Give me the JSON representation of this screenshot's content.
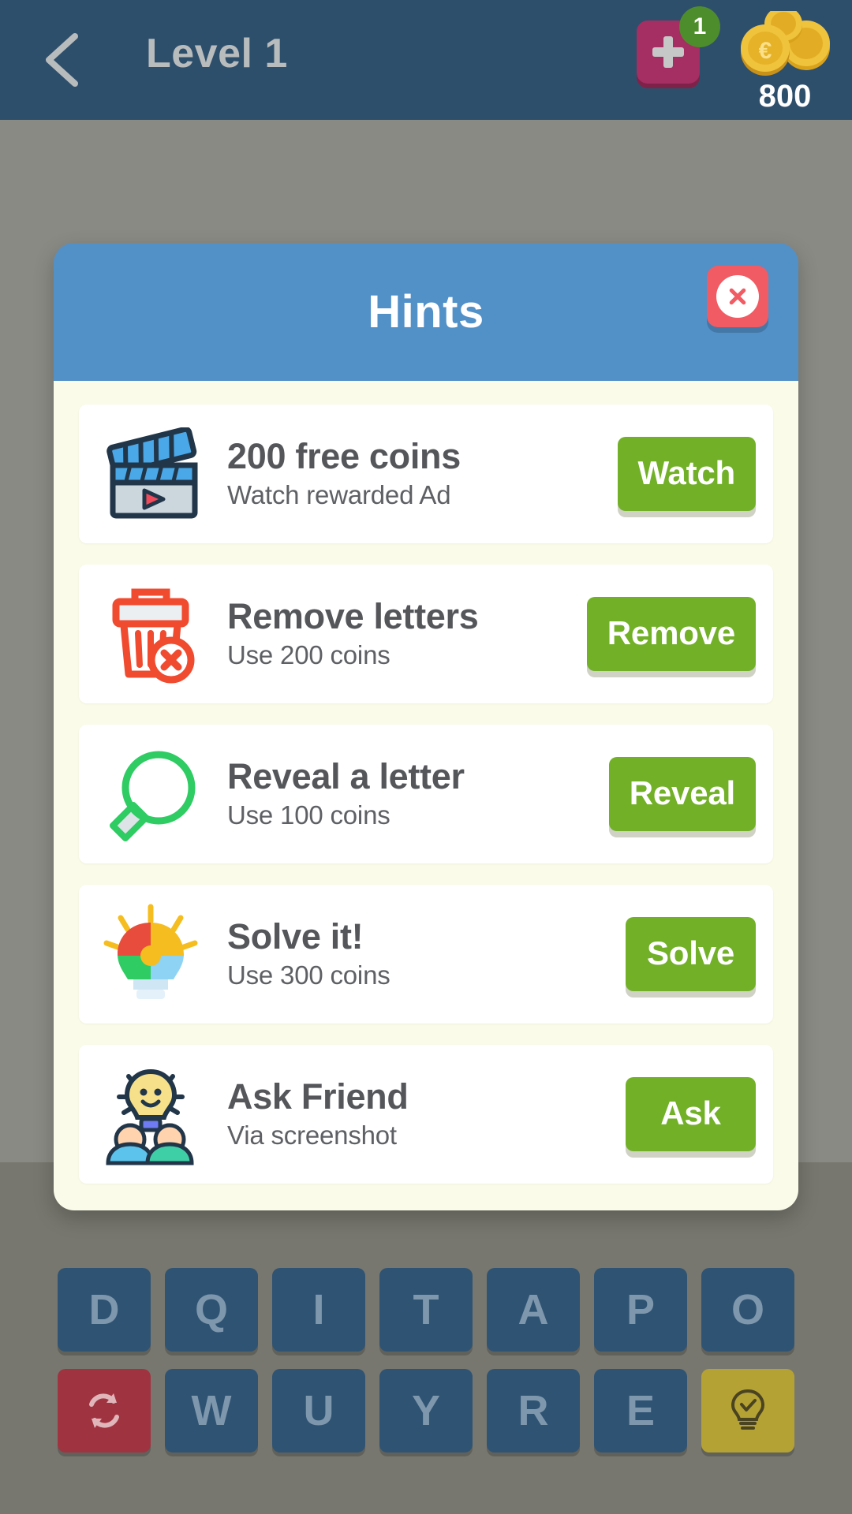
{
  "header": {
    "back_icon": "chevron-left-icon",
    "title": "Level 1",
    "add_button_icon": "plus-icon",
    "add_button_badge": "1",
    "coin_icon": "coin-stack-icon",
    "coin_count": "800",
    "bg_color": "#2e4f6b",
    "title_color": "#b9bcbd",
    "add_button_color": "#a52e63",
    "badge_color": "#4e8d2b"
  },
  "dialog": {
    "title": "Hints",
    "close_icon": "close-icon",
    "header_color": "#5290c8",
    "body_color": "#fbfbe9",
    "close_color": "#f15b63",
    "action_color": "#72b028",
    "hints": [
      {
        "icon": "clapperboard-video-icon",
        "title": "200 free coins",
        "subtitle": "Watch rewarded Ad",
        "action": "Watch"
      },
      {
        "icon": "trash-remove-icon",
        "title": "Remove letters",
        "subtitle": "Use 200 coins",
        "action": "Remove"
      },
      {
        "icon": "magnifier-search-icon",
        "title": "Reveal a letter",
        "subtitle": "Use 100 coins",
        "action": "Reveal"
      },
      {
        "icon": "lightbulb-puzzle-icon",
        "title": "Solve it!",
        "subtitle": "Use 300 coins",
        "action": "Solve"
      },
      {
        "icon": "friends-lightbulb-icon",
        "title": "Ask Friend",
        "subtitle": "Via screenshot",
        "action": "Ask"
      }
    ]
  },
  "keyboard": {
    "row1": [
      {
        "label": "D",
        "type": "letter"
      },
      {
        "label": "Q",
        "type": "letter"
      },
      {
        "label": "I",
        "type": "letter"
      },
      {
        "label": "T",
        "type": "letter"
      },
      {
        "label": "A",
        "type": "letter"
      },
      {
        "label": "P",
        "type": "letter"
      },
      {
        "label": "O",
        "type": "letter"
      }
    ],
    "row2": [
      {
        "label": "",
        "type": "shuffle",
        "icon": "shuffle-refresh-icon"
      },
      {
        "label": "W",
        "type": "letter"
      },
      {
        "label": "U",
        "type": "letter"
      },
      {
        "label": "Y",
        "type": "letter"
      },
      {
        "label": "R",
        "type": "letter"
      },
      {
        "label": "E",
        "type": "letter"
      },
      {
        "label": "",
        "type": "bulb",
        "icon": "lightbulb-hint-icon"
      }
    ],
    "key_color": "#2f5373",
    "shuffle_color": "#a03340",
    "bulb_color": "#b5a235"
  }
}
